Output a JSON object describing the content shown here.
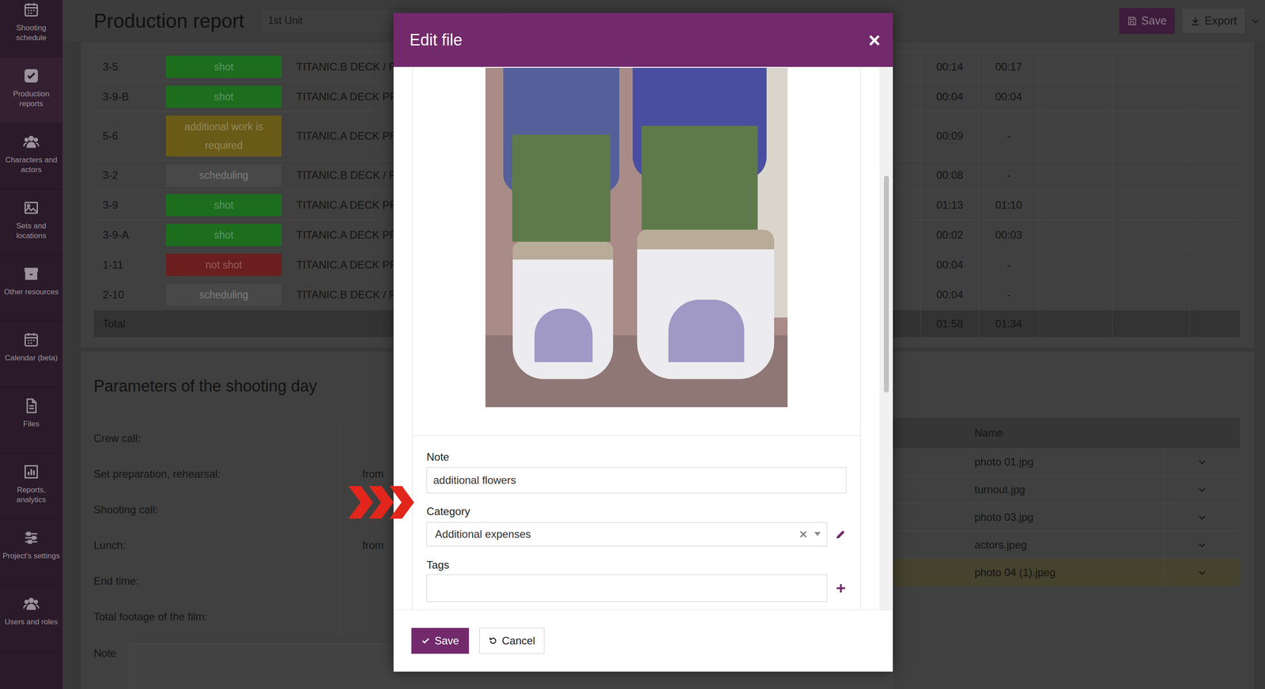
{
  "sidebar": {
    "items": [
      {
        "label": "Shooting schedule",
        "selected": false
      },
      {
        "label": "Production reports",
        "selected": true
      },
      {
        "label": "Characters and actors",
        "selected": false
      },
      {
        "label": "Sets and locations",
        "selected": false
      },
      {
        "label": "Other resources",
        "selected": false
      },
      {
        "label": "Calendar (beta)",
        "selected": false
      },
      {
        "label": "Files",
        "selected": false
      },
      {
        "label": "Reports, analytics",
        "selected": false
      },
      {
        "label": "Project's settings",
        "selected": false
      },
      {
        "label": "Users and roles",
        "selected": false
      }
    ]
  },
  "header": {
    "title": "Production report",
    "unit": "1st Unit",
    "save": "Save",
    "export": "Export"
  },
  "scenes": {
    "rows": [
      {
        "scene": "3-5",
        "status": "shot",
        "color": "#1d6d1f",
        "set": "TITANIC.B DECK / R",
        "time1": "00:14",
        "time2": "00:17"
      },
      {
        "scene": "3-9-B",
        "status": "shot",
        "color": "#1d6d1f",
        "set": "TITANIC.A DECK PR",
        "time1": "00:04",
        "time2": "00:04"
      },
      {
        "scene": "5-6",
        "status": "additional work is required",
        "color": "#6a5a18",
        "set": "TITANIC.A DECK PR",
        "time1": "00:09",
        "time2": "-"
      },
      {
        "scene": "3-2",
        "status": "scheduling",
        "color": "#484848",
        "set": "TITANIC.B DECK / R",
        "time1": "00:08",
        "time2": "-"
      },
      {
        "scene": "3-9",
        "status": "shot",
        "color": "#1d6d1f",
        "set": "TITANIC.A DECK PR",
        "time1": "01:13",
        "time2": "01:10"
      },
      {
        "scene": "3-9-A",
        "status": "shot",
        "color": "#1d6d1f",
        "set": "TITANIC.A DECK PR",
        "time1": "00:02",
        "time2": "00:03"
      },
      {
        "scene": "1-11",
        "status": "not shot",
        "color": "#6a1e1e",
        "set": "TITANIC.A DECK PR",
        "time1": "00:04",
        "time2": "-"
      },
      {
        "scene": "2-10",
        "status": "scheduling",
        "color": "#484848",
        "set": "TITANIC.B DECK / R",
        "time1": "00:04",
        "time2": "-"
      }
    ],
    "total": {
      "label": "Total",
      "time1": "01:58",
      "time2": "01:34"
    }
  },
  "parameters": {
    "title": "Parameters of the shooting day",
    "rows": [
      {
        "label": "Crew call:",
        "kind": "single"
      },
      {
        "label": "Set preparation, rehearsal:",
        "kind": "range",
        "from": "from"
      },
      {
        "label": "Shooting call:",
        "kind": "single"
      },
      {
        "label": "Lunch:",
        "kind": "range",
        "from": "from"
      },
      {
        "label": "End time:",
        "kind": "single"
      },
      {
        "label": "Total footage of the film:",
        "kind": "single"
      }
    ],
    "note": "Note"
  },
  "files": {
    "column": "Name",
    "rows": [
      {
        "name": "photo 01.jpg",
        "selected": false
      },
      {
        "name": "turnout.jpg",
        "selected": false
      },
      {
        "name": "photo 03.jpg",
        "selected": false
      },
      {
        "name": "actors.jpeg",
        "selected": false
      },
      {
        "name": "photo 04 (1).jpeg",
        "selected": true
      }
    ]
  },
  "modal": {
    "title": "Edit file",
    "close": "×",
    "note": {
      "label": "Note",
      "value": "additional flowers"
    },
    "category": {
      "label": "Category",
      "value": "Additional expenses",
      "clear": "×"
    },
    "tags": {
      "label": "Tags"
    },
    "buttons": [
      {
        "label": "Save",
        "kind": "primary"
      },
      {
        "label": "Cancel",
        "kind": "secondary"
      }
    ]
  }
}
